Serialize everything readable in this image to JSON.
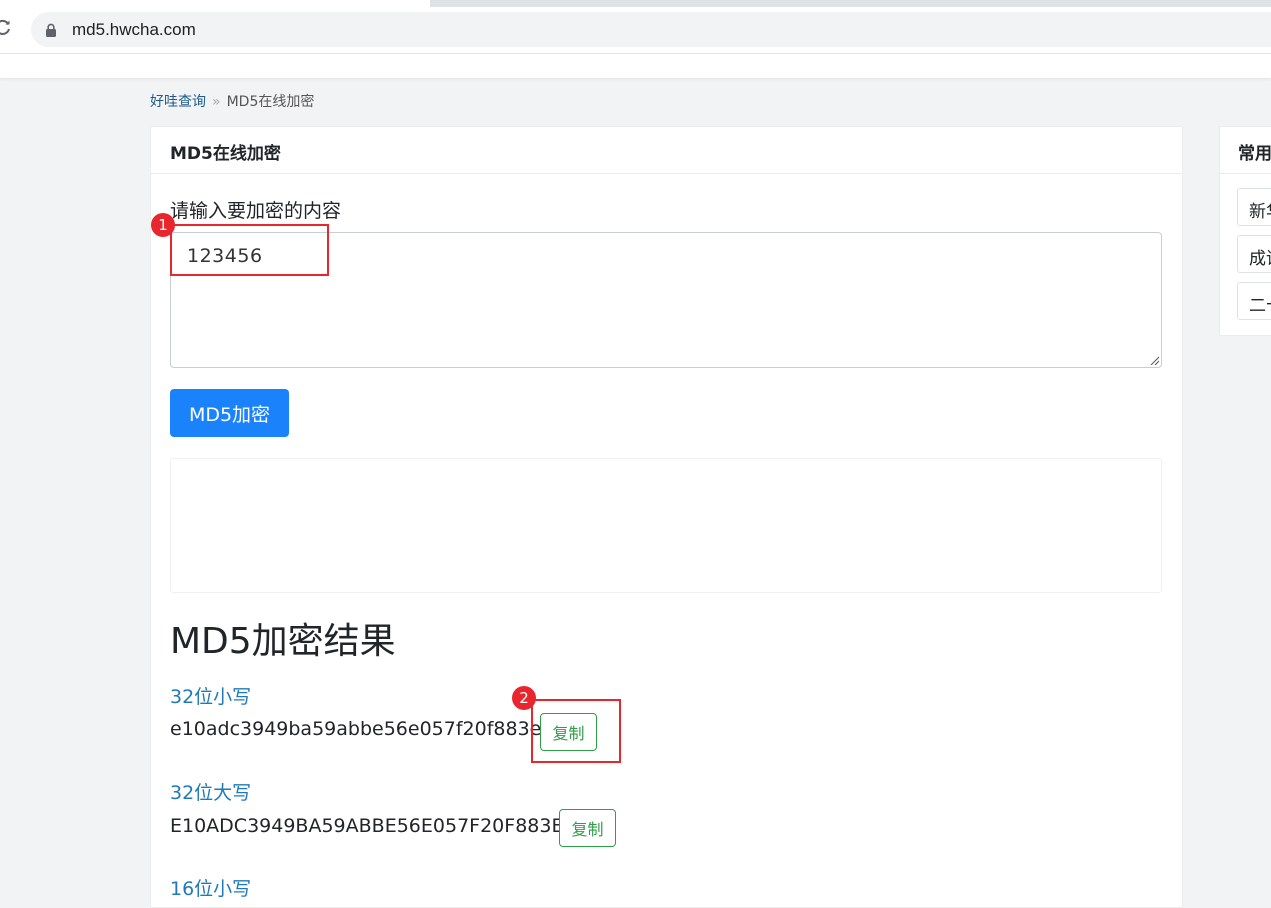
{
  "browser": {
    "url": "md5.hwcha.com"
  },
  "breadcrumb": {
    "home": "好哇查询",
    "separator": "»",
    "current": "MD5在线加密"
  },
  "card": {
    "title": "MD5在线加密",
    "input_label": "请输入要加密的内容",
    "input_value": "123456",
    "submit_label": "MD5加密"
  },
  "results": {
    "heading": "MD5加密结果",
    "items": [
      {
        "label": "32位小写",
        "value": "e10adc3949ba59abbe56e057f20f883e",
        "copy_label": "复制"
      },
      {
        "label": "32位大写",
        "value": "E10ADC3949BA59ABBE56E057F20F883E",
        "copy_label": "复制"
      },
      {
        "label": "16位小写"
      }
    ]
  },
  "sidebar": {
    "title": "常用",
    "items": [
      "新华",
      "成语",
      "二十"
    ]
  },
  "annotations": {
    "badge_1": "1",
    "badge_2": "2",
    "color": "#e8262d"
  },
  "colors": {
    "primary_button": "#1a82fb",
    "copy_button": "#2e9e46",
    "result_label": "#1f7ab9"
  }
}
